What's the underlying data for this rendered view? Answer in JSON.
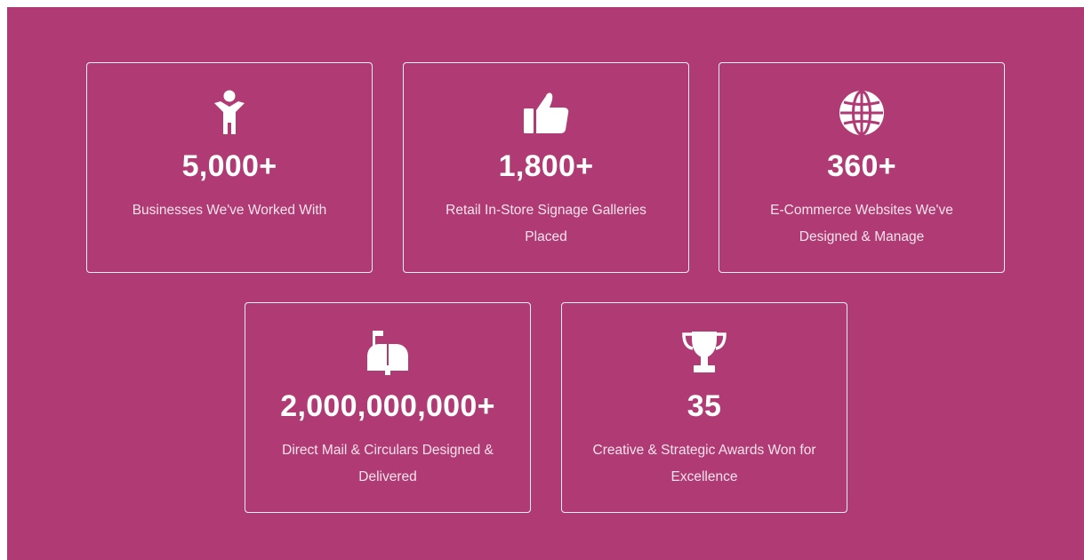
{
  "page": {
    "background_color": "#b03a73",
    "text_color": "#ffffff"
  },
  "stats": [
    {
      "icon": "person-icon",
      "number": "5,000+",
      "label": "Businesses We've Worked With"
    },
    {
      "icon": "thumbs-up-icon",
      "number": "1,800+",
      "label": "Retail In-Store Signage Galleries Placed"
    },
    {
      "icon": "globe-icon",
      "number": "360+",
      "label": "E-Commerce Websites We've Designed & Manage"
    },
    {
      "icon": "mailbox-icon",
      "number": "2,000,000,000+",
      "label": "Direct Mail & Circulars Designed & Delivered"
    },
    {
      "icon": "trophy-icon",
      "number": "35",
      "label": "Creative & Strategic Awards Won for Excellence"
    }
  ]
}
